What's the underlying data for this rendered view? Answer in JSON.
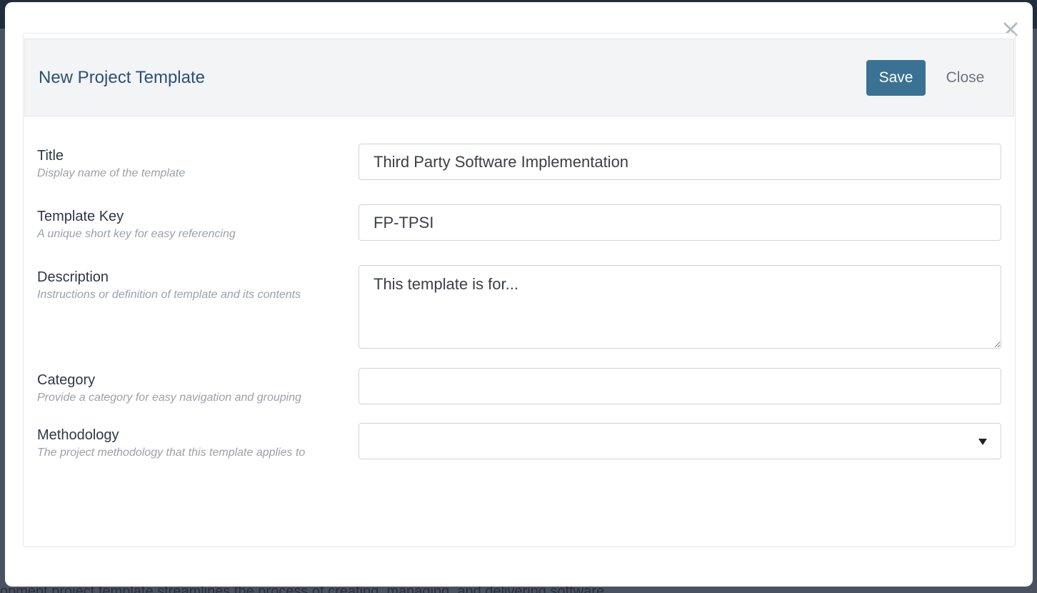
{
  "backdrop": {
    "text": "opment project template streamlines the process of creating, managing, and delivering software"
  },
  "modal": {
    "title": "New Project Template",
    "save_label": "Save",
    "close_label": "Close",
    "close_icon": "close-icon"
  },
  "fields": {
    "title": {
      "label": "Title",
      "hint": "Display name of the template",
      "value": "Third Party Software Implementation"
    },
    "template_key": {
      "label": "Template Key",
      "hint": "A unique short key for easy referencing",
      "value": "FP-TPSI"
    },
    "description": {
      "label": "Description",
      "hint": "Instructions or definition of template and its contents",
      "placeholder": "This template is for..."
    },
    "category": {
      "label": "Category",
      "hint": "Provide a category for easy navigation and grouping",
      "value": ""
    },
    "methodology": {
      "label": "Methodology",
      "hint": "The project methodology that this template applies to",
      "value": ""
    }
  },
  "colors": {
    "accent": "#3a7294",
    "title": "#2c4f75",
    "header_bg": "#f3f4f6"
  }
}
